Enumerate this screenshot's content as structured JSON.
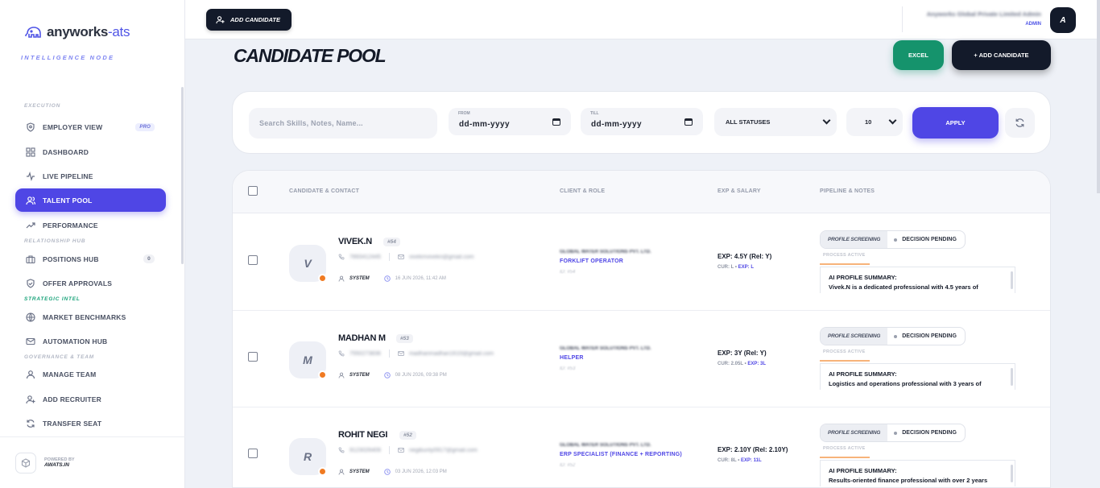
{
  "brand": {
    "logo": "anyworks",
    "logo_suffix": "-ats",
    "tagline": "INTELLIGENCE NODE"
  },
  "sidebar": {
    "sections": {
      "execution": "EXECUTION",
      "relationship": "RELATIONSHIP HUB",
      "strategic": "STRATEGIC INTEL",
      "governance": "GOVERNANCE & TEAM"
    },
    "items": [
      {
        "label": "EMPLOYER VIEW",
        "icon": "shield-icon",
        "badge": "PRO"
      },
      {
        "label": "DASHBOARD",
        "icon": "grid-icon"
      },
      {
        "label": "LIVE PIPELINE",
        "icon": "activity-icon"
      },
      {
        "label": "TALENT POOL",
        "icon": "users-icon",
        "active": true
      },
      {
        "label": "PERFORMANCE",
        "icon": "trending-icon"
      },
      {
        "label": "POSITIONS HUB",
        "icon": "briefcase-icon",
        "badge": "0"
      },
      {
        "label": "OFFER APPROVALS",
        "icon": "shield-check-icon"
      },
      {
        "label": "MARKET BENCHMARKS",
        "icon": "globe-icon"
      },
      {
        "label": "AUTOMATION HUB",
        "icon": "mail-icon"
      },
      {
        "label": "MANAGE TEAM",
        "icon": "user-icon"
      },
      {
        "label": "ADD RECRUITER",
        "icon": "user-plus-icon"
      },
      {
        "label": "TRANSFER SEAT",
        "icon": "refresh-icon"
      }
    ],
    "footer": {
      "powered_by": "POWERED BY",
      "powered_name": "AWATS.IN"
    }
  },
  "topbar": {
    "add_candidate": "ADD CANDIDATE",
    "org_name": "Anyworks Global Private Limited Admin",
    "org_role": "ADMIN",
    "avatar": "A"
  },
  "page": {
    "title": "CANDIDATE POOL",
    "excel": "EXCEL",
    "add_candidate": "+ ADD CANDIDATE"
  },
  "filters": {
    "search_placeholder": "Search Skills, Notes, Name...",
    "from_label": "FROM",
    "from_value": "dd-mm-yyyy",
    "till_label": "TILL",
    "till_value": "dd-mm-yyyy",
    "status": "ALL STATUSES",
    "page_size": "10",
    "apply": "APPLY"
  },
  "table": {
    "headers": {
      "candidate": "CANDIDATE & CONTACT",
      "client": "CLIENT & ROLE",
      "exp": "EXP & SALARY",
      "pipeline": "PIPELINE & NOTES"
    },
    "rows": [
      {
        "initial": "V",
        "name": "VIVEK.N",
        "id": "#54",
        "phone": "7893412445",
        "email": "vivekmvivekn@gmail.com",
        "source": "SYSTEM",
        "timestamp": "16 JUN 2026, 11:42 AM",
        "client": "GLOBAL WATER SOLUTIONS PVT. LTD.",
        "role": "FORKLIFT OPERATOR",
        "client_id": "ID: #54",
        "exp": "EXP: 4.5Y (Rel: Y)",
        "cur": "CUR: L",
        "cur_exp": "EXP: L",
        "stage": "PROFILE SCREENING",
        "status": "DECISION PENDING",
        "process": "PROCESS ACTIVE",
        "note_title": "AI PROFILE SUMMARY:",
        "note_body": "Vivek.N is a dedicated professional with 4.5 years of"
      },
      {
        "initial": "M",
        "name": "MADHAN M",
        "id": "#53",
        "phone": "7550273836",
        "email": "madhanmadhan1610@gmail.com",
        "source": "SYSTEM",
        "timestamp": "08 JUN 2026, 09:38 PM",
        "client": "GLOBAL WATER SOLUTIONS PVT. LTD.",
        "role": "HELPER",
        "client_id": "ID: #53",
        "exp": "EXP: 3Y (Rel: Y)",
        "cur": "CUR: 2.05L",
        "cur_exp": "EXP: 3L",
        "stage": "PROFILE SCREENING",
        "status": "DECISION PENDING",
        "process": "PROCESS ACTIVE",
        "note_title": "AI PROFILE SUMMARY:",
        "note_body": "Logistics and operations professional with 3 years of"
      },
      {
        "initial": "R",
        "name": "ROHIT NEGI",
        "id": "#52",
        "phone": "9123026409",
        "email": "negibunty0917@gmail.com",
        "source": "SYSTEM",
        "timestamp": "03 JUN 2026, 12:03 PM",
        "client": "GLOBAL WATER SOLUTIONS PVT. LTD.",
        "role": "ERP SPECIALIST (FINANCE + REPORTING)",
        "client_id": "ID: #52",
        "exp": "EXP: 2.10Y (Rel: 2.10Y)",
        "cur": "CUR: 8L",
        "cur_exp": "EXP: 11L",
        "stage": "PROFILE SCREENING",
        "status": "DECISION PENDING",
        "process": "PROCESS ACTIVE",
        "note_title": "AI PROFILE SUMMARY:",
        "note_body": "Results-oriented finance professional with over 2 years"
      }
    ]
  },
  "colors": {
    "primary": "#4f46e5",
    "excel": "#15936c",
    "dark": "#131a2a",
    "status_dot": "#f07a22"
  }
}
